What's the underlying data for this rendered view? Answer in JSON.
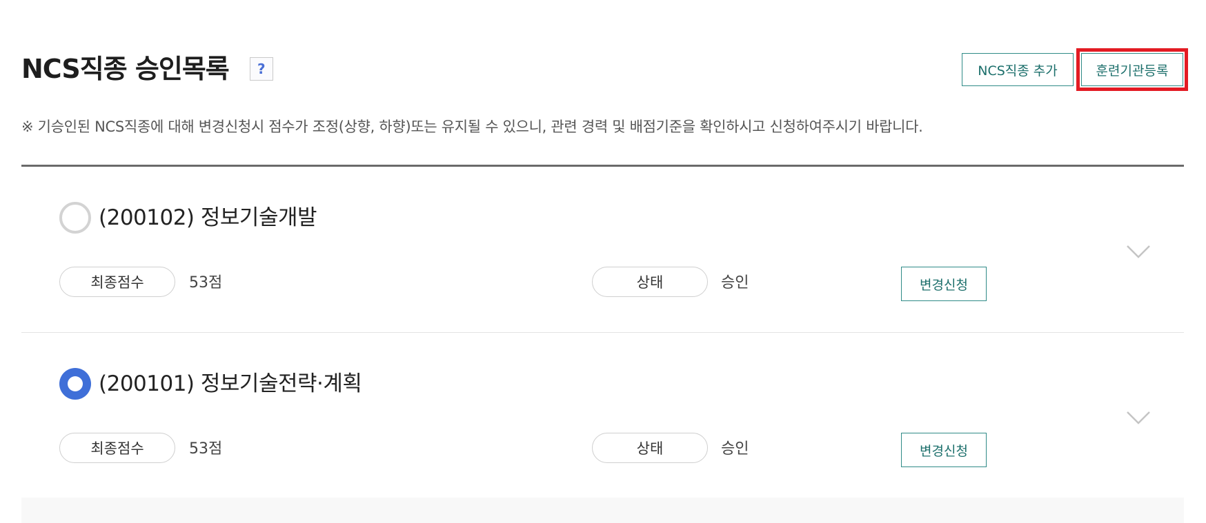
{
  "header": {
    "title": "NCS직종 승인목록",
    "help_icon": "?"
  },
  "buttons": {
    "add_ncs": "NCS직종 추가",
    "register_institution": "훈련기관등록"
  },
  "notice": "※ 기승인된 NCS직종에 대해 변경신청시 점수가 조정(상향, 하향)또는 유지될 수 있으니, 관련 경력 및 배점기준을 확인하시고 신청하여주시기 바랍니다.",
  "items": [
    {
      "title": "(200102) 정보기술개발",
      "selected": false,
      "score_label": "최종점수",
      "score_value": "53점",
      "status_label": "상태",
      "status_value": "승인",
      "change_button": "변경신청"
    },
    {
      "title": "(200101) 정보기술전략·계획",
      "selected": true,
      "score_label": "최종점수",
      "score_value": "53점",
      "status_label": "상태",
      "status_value": "승인",
      "change_button": "변경신청"
    }
  ],
  "colors": {
    "accent_teal": "#2e8a86",
    "radio_selected": "#3f6fd8",
    "highlight_red": "#e31b23"
  },
  "icons": {
    "help": "question-icon",
    "expand": "chevron-down-icon"
  }
}
